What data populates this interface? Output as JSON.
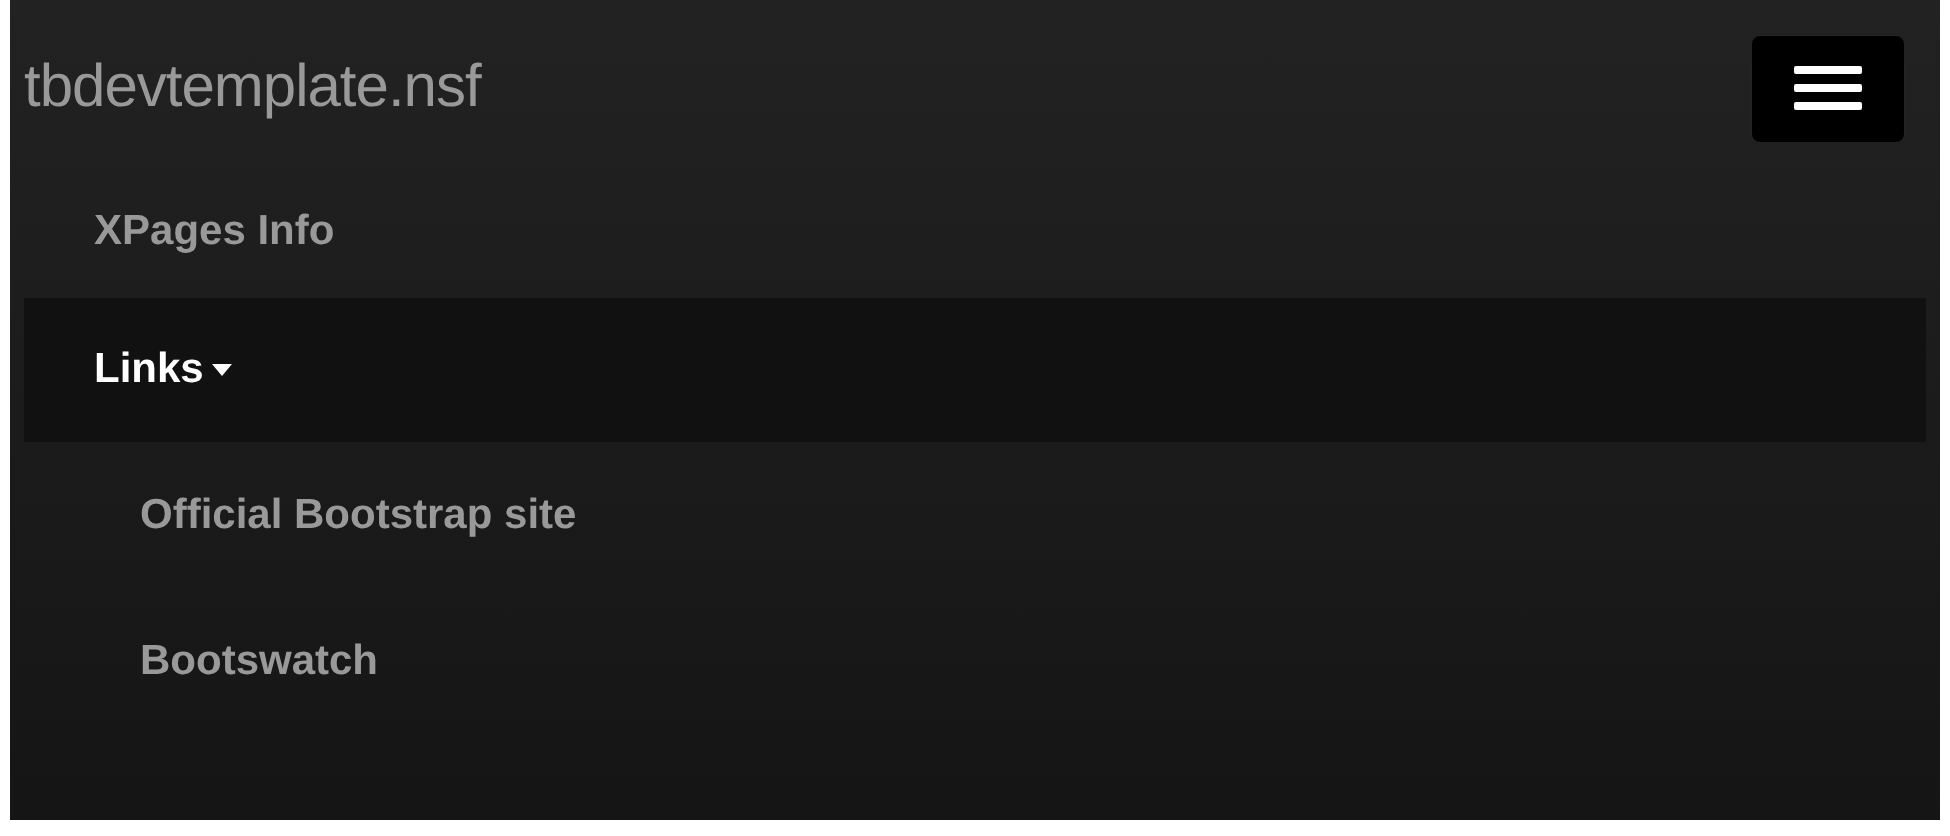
{
  "navbar": {
    "brand": "tbdevtemplate.nsf",
    "toggle_expanded": true,
    "items": [
      {
        "kind": "link",
        "label": "XPages Info",
        "selected": false
      },
      {
        "kind": "dropdown",
        "label": "Links",
        "selected": true,
        "expanded": true,
        "children": [
          {
            "label": "Official Bootstrap site"
          },
          {
            "label": "Bootswatch"
          }
        ]
      }
    ]
  }
}
